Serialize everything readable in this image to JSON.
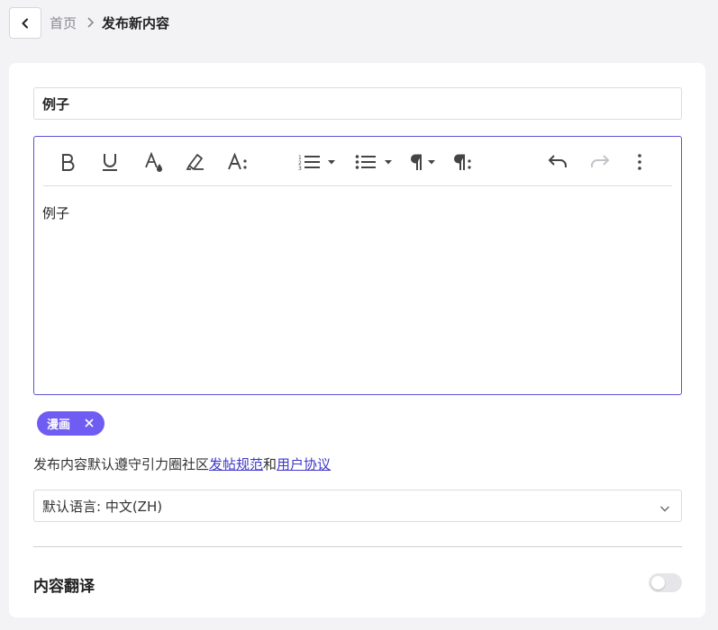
{
  "breadcrumb": {
    "home": "首页",
    "current": "发布新内容"
  },
  "post": {
    "title_value": "例子",
    "body_text": "例子"
  },
  "toolbar": {
    "buttons": [
      "bold-icon",
      "underline-icon",
      "text-color-icon",
      "highlight-icon",
      "font-size-icon",
      "ordered-list-icon",
      "bullet-list-icon",
      "paragraph-icon",
      "paragraph-format-icon",
      "undo-icon",
      "redo-icon",
      "more-icon"
    ]
  },
  "tags": [
    {
      "label": "漫画"
    }
  ],
  "notice": {
    "prefix": "发布内容默认遵守引力圈社区",
    "link1": "发帖规范",
    "middle": "和",
    "link2": "用户协议"
  },
  "language_select": {
    "value": "默认语言: 中文(ZH)"
  },
  "translation": {
    "label": "内容翻译",
    "enabled": false
  },
  "colors": {
    "accent": "#6f5cf2",
    "editor_border": "#5b4fd6",
    "link": "#3f37c9",
    "background": "#f3f3f5"
  }
}
